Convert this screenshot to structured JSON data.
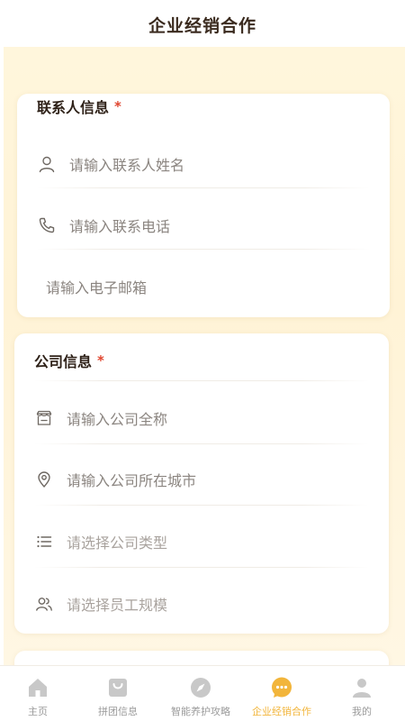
{
  "header": {
    "title": "企业经销合作"
  },
  "contact": {
    "title": "联系人信息",
    "required_mark": "*",
    "name_placeholder": "请输入联系人姓名",
    "phone_placeholder": "请输入联系电话",
    "email_placeholder": "请输入电子邮箱"
  },
  "company": {
    "title": "公司信息",
    "required_mark": "*",
    "fullname_placeholder": "请输入公司全称",
    "city_placeholder": "请输入公司所在城市",
    "type_placeholder": "请选择公司类型",
    "staff_placeholder": "请选择员工规模"
  },
  "tabbar": {
    "items": [
      {
        "label": "主页",
        "icon": "home-icon"
      },
      {
        "label": "拼团信息",
        "icon": "bag-icon"
      },
      {
        "label": "智能养护攻略",
        "icon": "compass-icon"
      },
      {
        "label": "企业经销合作",
        "icon": "chat-icon"
      },
      {
        "label": "我的",
        "icon": "user-icon"
      }
    ],
    "active_index": 3
  },
  "colors": {
    "accent": "#f2b53b",
    "required": "#e0452f",
    "panel_bg": "#fff6dc",
    "inactive_icon": "#c8c8c8"
  }
}
